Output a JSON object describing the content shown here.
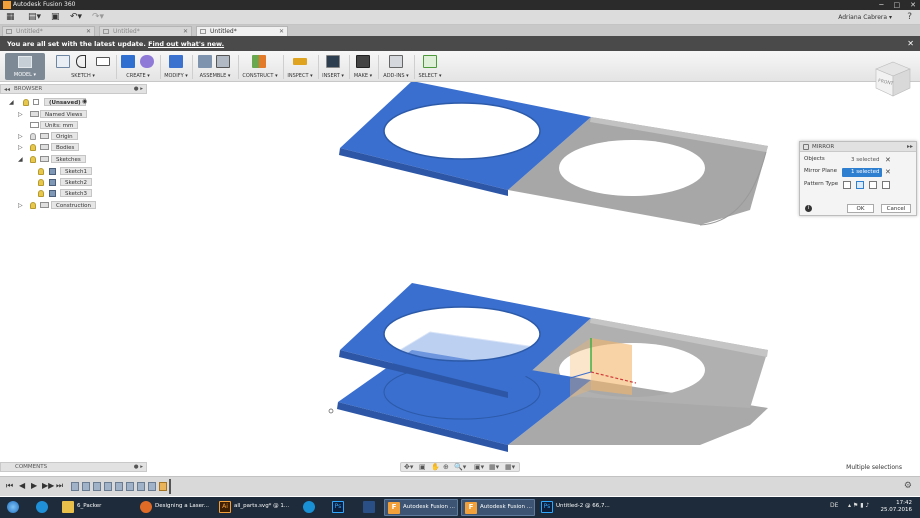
{
  "window": {
    "title": "Autodesk Fusion 360",
    "min": "─",
    "max": "□",
    "close": "✕"
  },
  "quick_access": {
    "grid_icon": "▦",
    "file_icon": "▤▾",
    "save_icon": "▣",
    "undo_icon": "↶▾",
    "redo_icon": "↷▾",
    "user": "Adriana Cabrera ▾",
    "help_icon": "?"
  },
  "tabs": [
    {
      "label": "Untitled*",
      "active": false
    },
    {
      "label": "Untitled*",
      "active": false
    },
    {
      "label": "Untitled*",
      "active": true
    }
  ],
  "banner": {
    "message": "You are all set with the latest update.",
    "link": "Find out what's new.",
    "close": "✕"
  },
  "toolbar": {
    "model": "MODEL ▾",
    "groups": [
      {
        "label": "SKETCH ▾"
      },
      {
        "label": "CREATE ▾"
      },
      {
        "label": "MODIFY ▾"
      },
      {
        "label": "ASSEMBLE ▾"
      },
      {
        "label": "CONSTRUCT ▾"
      },
      {
        "label": "INSPECT ▾"
      },
      {
        "label": "INSERT ▾"
      },
      {
        "label": "MAKE ▾"
      },
      {
        "label": "ADD-INS ▾"
      },
      {
        "label": "SELECT ▾"
      }
    ]
  },
  "browser": {
    "title": "BROWSER",
    "collapse": "◂◂",
    "pin": "● ▸",
    "root": "(Unsaved)",
    "nodes": {
      "named_views": "Named Views",
      "units": "Units: mm",
      "origin": "Origin",
      "bodies": "Bodies",
      "sketches": "Sketches",
      "sketch1": "Sketch1",
      "sketch2": "Sketch2",
      "sketch3": "Sketch3",
      "construction": "Construction"
    }
  },
  "comments": {
    "title": "COMMENTS",
    "right": "● ▸"
  },
  "viewcube": {
    "label": "FRONT"
  },
  "mirror_dialog": {
    "title": "MIRROR",
    "pin": "▸▸",
    "objects_label": "Objects",
    "objects_value": "3 selected",
    "plane_label": "Mirror Plane",
    "plane_value": "1 selected",
    "pattern_label": "Pattern Type",
    "ok": "OK",
    "cancel": "Cancel",
    "info": "i",
    "clear": "✕"
  },
  "status": {
    "message": "Multiple selections"
  },
  "navbar": {
    "icons": [
      "✥▾",
      "▣",
      "✋",
      "⊕",
      "🔍▾",
      "▣▾",
      "▦▾",
      "▦▾"
    ]
  },
  "timeline": {
    "controls": [
      "⏮",
      "◀",
      "▶",
      "▶▶",
      "⏭"
    ],
    "gear": "⚙"
  },
  "taskbar": {
    "items": [
      {
        "label": "",
        "color": "#1f6fc2"
      },
      {
        "label": "6_Packer",
        "color": "#e8c04a"
      },
      {
        "label": "Designing a Laser...",
        "color": "#e06b27"
      },
      {
        "label": "all_parts.svg* @ 1...",
        "color": "#f2a03a"
      },
      {
        "label": "",
        "color": "#1a90d4"
      },
      {
        "label": "",
        "color": "#2a4e86"
      },
      {
        "label": "Autodesk Fusion ...",
        "color": "#f2a03a"
      },
      {
        "label": "Autodesk Fusion ...",
        "color": "#f2a03a"
      },
      {
        "label": "Untitled-2 @ 66,7...",
        "color": "#2a4e86"
      }
    ],
    "lang": "DE",
    "time": "17:42",
    "date": "25.07.2016"
  },
  "colors": {
    "body_blue": "#3a6fcf",
    "body_grey": "#a9a9a9",
    "accent": "#2f7fd1"
  }
}
